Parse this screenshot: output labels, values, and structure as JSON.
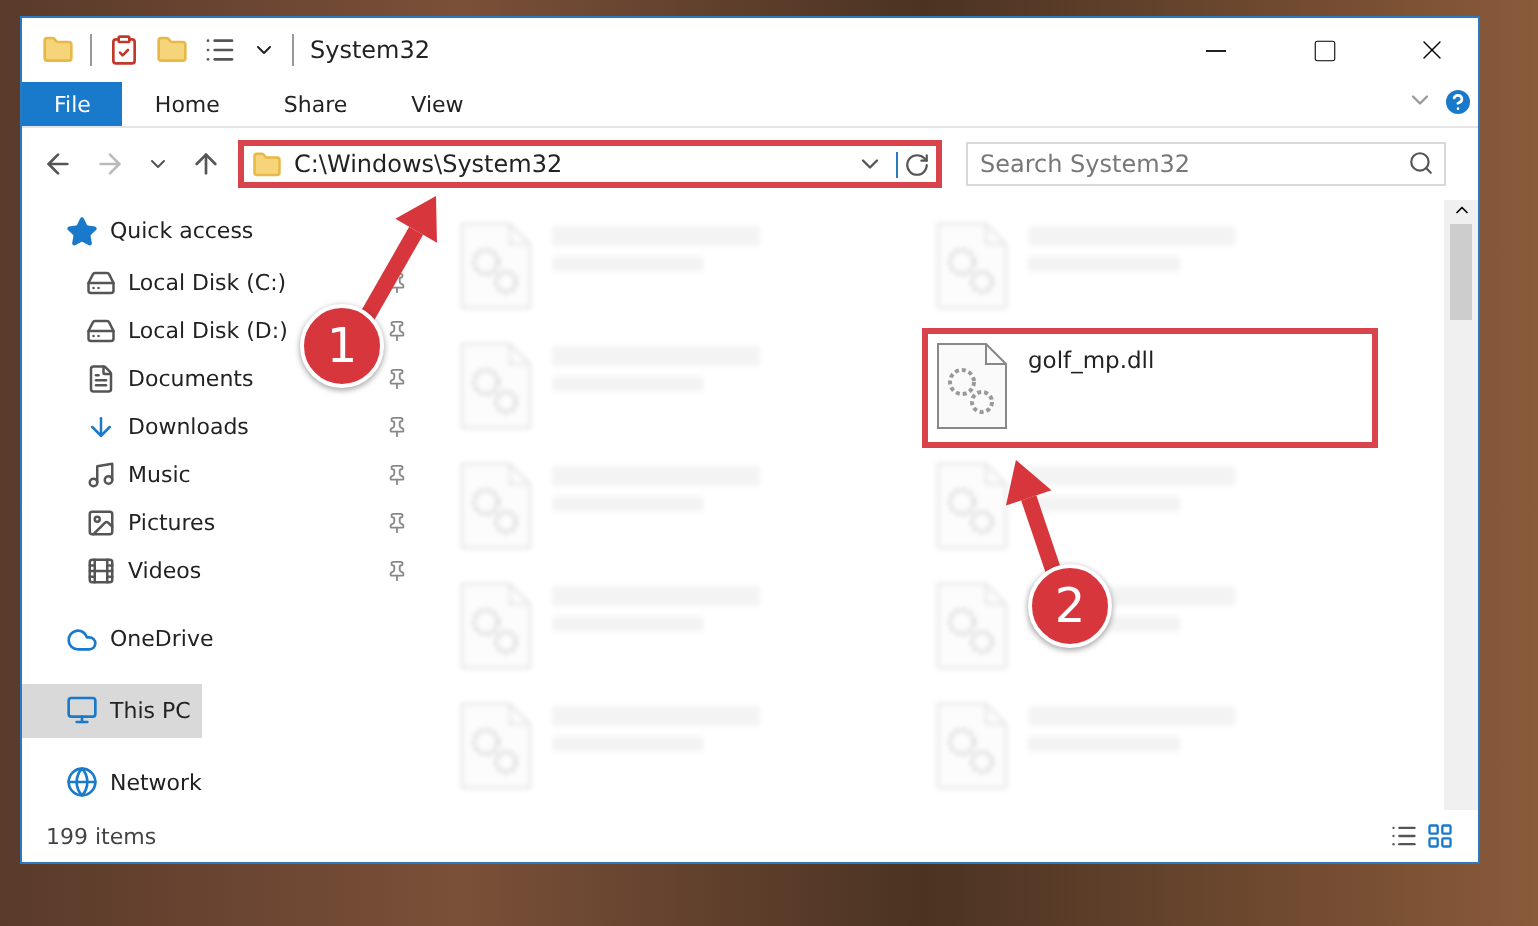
{
  "window": {
    "title": "System32"
  },
  "ribbon_tabs": [
    {
      "label": "File",
      "selected": true
    },
    {
      "label": "Home",
      "selected": false
    },
    {
      "label": "Share",
      "selected": false
    },
    {
      "label": "View",
      "selected": false
    }
  ],
  "address": {
    "path": "C:\\Windows\\System32",
    "highlighted": true
  },
  "search": {
    "placeholder": "Search System32"
  },
  "sidebar": {
    "items": [
      {
        "label": "Quick access",
        "selected": false,
        "children": [
          {
            "label": "Local Disk (C:)",
            "pinned": true,
            "selected": false
          },
          {
            "label": "Local Disk (D:)",
            "pinned": true,
            "selected": false
          },
          {
            "label": "Documents",
            "pinned": true,
            "selected": false
          },
          {
            "label": "Downloads",
            "pinned": true,
            "selected": false
          },
          {
            "label": "Music",
            "pinned": true,
            "selected": false
          },
          {
            "label": "Pictures",
            "pinned": true,
            "selected": false
          },
          {
            "label": "Videos",
            "pinned": true,
            "selected": false
          }
        ]
      },
      {
        "label": "OneDrive",
        "selected": false
      },
      {
        "label": "This PC",
        "selected": true
      },
      {
        "label": "Network",
        "selected": false
      }
    ]
  },
  "files": [
    {
      "blurred": true,
      "highlighted": false
    },
    {
      "blurred": true,
      "highlighted": false
    },
    {
      "blurred": true,
      "highlighted": false
    },
    {
      "name": "golf_mp.dll",
      "blurred": false,
      "highlighted": true
    },
    {
      "blurred": true,
      "highlighted": false
    },
    {
      "blurred": true,
      "highlighted": false
    },
    {
      "blurred": true,
      "highlighted": false
    },
    {
      "blurred": true,
      "highlighted": false
    },
    {
      "blurred": true,
      "highlighted": false
    },
    {
      "blurred": true,
      "highlighted": false
    }
  ],
  "status_bar": {
    "count": "199 items"
  },
  "annotations": [
    {
      "number": "1"
    },
    {
      "number": "2"
    }
  ]
}
